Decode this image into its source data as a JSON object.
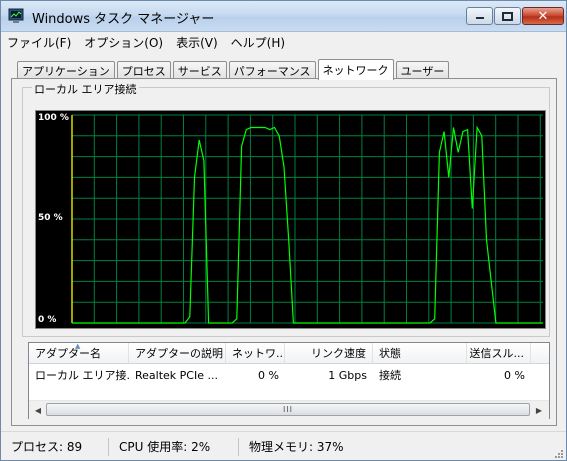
{
  "window": {
    "title": "Windows タスク マネージャー"
  },
  "menu": [
    "ファイル(F)",
    "オプション(O)",
    "表示(V)",
    "ヘルプ(H)"
  ],
  "tabs": [
    {
      "label": "アプリケーション",
      "active": false
    },
    {
      "label": "プロセス",
      "active": false
    },
    {
      "label": "サービス",
      "active": false
    },
    {
      "label": "パフォーマンス",
      "active": false
    },
    {
      "label": "ネットワーク",
      "active": true
    },
    {
      "label": "ユーザー",
      "active": false
    }
  ],
  "graph": {
    "group_label": "ローカル エリア接続",
    "y_labels": [
      "100 %",
      "50 %",
      "0 %"
    ],
    "line_color": "#00ff00",
    "grid_color": "#008040"
  },
  "chart_data": {
    "type": "line",
    "ylim": [
      0,
      100
    ],
    "x": [
      0,
      1,
      2,
      3,
      4,
      5,
      6,
      7,
      8,
      9,
      10,
      11,
      12,
      13,
      14,
      15,
      16,
      17,
      18,
      19,
      20,
      21,
      22,
      23,
      24,
      25,
      26,
      27,
      28,
      29,
      30,
      31,
      32,
      33,
      34,
      35,
      36,
      37,
      38,
      39,
      40,
      41,
      42,
      43,
      44,
      45,
      46,
      47,
      48,
      49,
      50,
      51,
      52,
      53,
      54,
      55,
      56,
      57,
      58,
      59,
      60,
      61,
      62,
      63,
      64,
      65,
      66,
      67,
      68,
      69,
      70,
      71,
      72,
      73,
      74,
      75,
      76,
      77,
      78,
      79,
      80,
      81,
      82,
      83,
      84,
      85,
      86,
      87,
      88,
      89,
      90,
      91,
      92,
      93,
      94,
      95,
      96,
      97,
      98,
      99,
      100
    ],
    "values": [
      0,
      0,
      0,
      0,
      0,
      0,
      0,
      0,
      0,
      0,
      0,
      0,
      0,
      0,
      0,
      0,
      0,
      0,
      0,
      0,
      0,
      0,
      0,
      0,
      0,
      3,
      70,
      88,
      78,
      0,
      0,
      0,
      0,
      0,
      0,
      2,
      85,
      93,
      94,
      94,
      94,
      94,
      93,
      94,
      90,
      75,
      40,
      0,
      0,
      0,
      0,
      0,
      0,
      0,
      0,
      0,
      0,
      0,
      0,
      0,
      0,
      0,
      0,
      0,
      0,
      0,
      0,
      0,
      0,
      0,
      0,
      0,
      0,
      0,
      0,
      0,
      0,
      2,
      82,
      92,
      70,
      94,
      82,
      92,
      93,
      55,
      94,
      90,
      40,
      20,
      0,
      0,
      0,
      0,
      0,
      0,
      0,
      0,
      0,
      0,
      0
    ]
  },
  "list": {
    "columns": [
      "アダプター名",
      "アダプターの説明",
      "ネットワ...",
      "リンク速度",
      "状態",
      "送信スル..."
    ],
    "rows": [
      [
        "ローカル エリア接...",
        "Realtek PCIe ...",
        "0 %",
        "1 Gbps",
        "接続",
        "0 %"
      ]
    ]
  },
  "scrollbar": {
    "thumb_grip": "III"
  },
  "status": {
    "processes": "プロセス: 89",
    "cpu": "CPU 使用率: 2%",
    "memory": "物理メモリ: 37%"
  }
}
